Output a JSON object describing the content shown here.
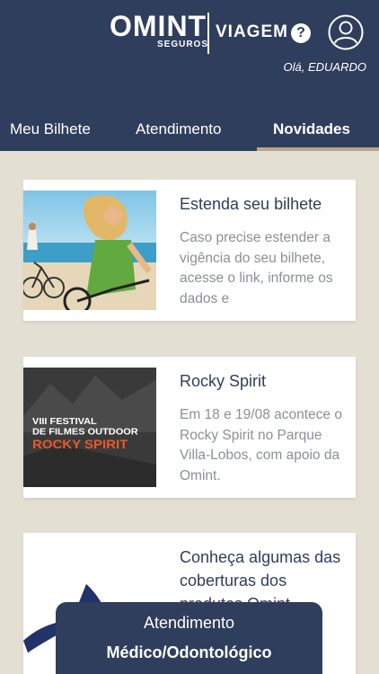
{
  "header": {
    "brand": "OMINT",
    "brand_sub": "SEGUROS",
    "product": "VIAGEM",
    "help_icon": "?",
    "greeting": "Olá, EDUARDO"
  },
  "tabs": [
    {
      "label": "Meu Bilhete"
    },
    {
      "label": "Atendimento"
    },
    {
      "label": "Novidades"
    }
  ],
  "news": [
    {
      "title": "Estenda seu bilhete",
      "description": "Caso precise estender a vigência do seu bilhete, acesse o link, informe os dados e"
    },
    {
      "title": "Rocky Spirit",
      "description": "Em 18 e 19/08 acontece o Rocky Spirit no Parque Villa-Lobos, com apoio da Omint.",
      "image_text": {
        "line1": "VIII FESTIVAL",
        "line2": "DE FILMES OUTDOOR",
        "line3": "ROCKY SPIRIT"
      }
    },
    {
      "title": "Conheça algumas das coberturas dos produtos Omint",
      "description": ""
    }
  ],
  "bottom_panel": {
    "title": "Atendimento",
    "subtitle": "Médico/Odontológico"
  },
  "colors": {
    "header_bg": "#2f3e5c",
    "page_bg": "#e4dfd3",
    "tab_underline": "#b8a68a",
    "accent_orange": "#e8592a"
  }
}
